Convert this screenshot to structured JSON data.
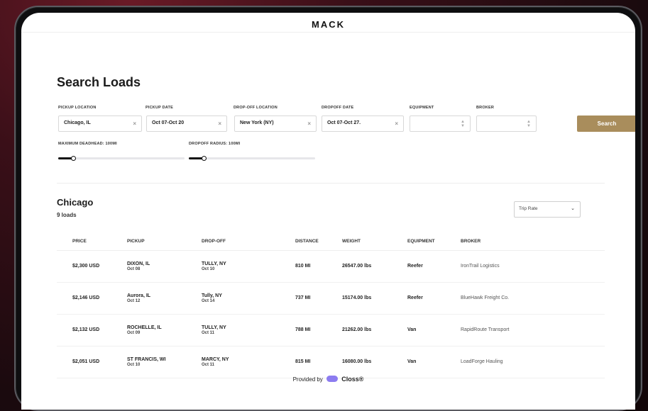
{
  "app": {
    "logo": "MACK"
  },
  "page": {
    "title": "Search Loads"
  },
  "search": {
    "pickup_location": {
      "label": "PICKUP LOCATION",
      "value": "Chicago, IL"
    },
    "pickup_date": {
      "label": "PICKUP DATE",
      "value": "Oct 07-Oct 20"
    },
    "dropoff_location": {
      "label": "DROP-OFF LOCATION",
      "value": "New York (NY)"
    },
    "dropoff_date": {
      "label": "DROPOFF DATE",
      "value": "Oct 07-Oct 27."
    },
    "equipment": {
      "label": "EQUIPMENT",
      "value": ""
    },
    "broker": {
      "label": "BROKER",
      "value": ""
    },
    "search_button": "Search",
    "max_deadhead": {
      "label": "MAXIMUM DEADHEAD: 100MI",
      "fraction": 0.12
    },
    "dropoff_radius": {
      "label": "DROPOFF RADIUS: 100MI",
      "fraction": 0.12
    },
    "clear_icon": "×"
  },
  "results": {
    "group_title": "Chicago",
    "count_text": "9 loads",
    "sort": {
      "value": "Trip Rate"
    },
    "columns": [
      "PRICE",
      "PICKUP",
      "DROP-OFF",
      "DISTANCE",
      "WEIGHT",
      "EQUIPMENT",
      "BROKER"
    ],
    "rows": [
      {
        "price": "$2,300 USD",
        "pickup_city": "DIXON, IL",
        "pickup_date": "Oct 08",
        "drop_city": "TULLY, NY",
        "drop_date": "Oct 10",
        "distance": "810 MI",
        "weight": "26547.00 lbs",
        "equipment": "Reefer",
        "broker": "IronTrail Logistics"
      },
      {
        "price": "$2,146 USD",
        "pickup_city": "Aurora, IL",
        "pickup_date": "Oct 12",
        "drop_city": "Tully, NY",
        "drop_date": "Oct 14",
        "distance": "737 MI",
        "weight": "15174.00 lbs",
        "equipment": "Reefer",
        "broker": "BlueHawk Freight Co."
      },
      {
        "price": "$2,132 USD",
        "pickup_city": "ROCHELLE, IL",
        "pickup_date": "Oct 09",
        "drop_city": "TULLY, NY",
        "drop_date": "Oct 11",
        "distance": "788 MI",
        "weight": "21262.00 lbs",
        "equipment": "Van",
        "broker": "RapidRoute Transport"
      },
      {
        "price": "$2,051 USD",
        "pickup_city": "ST FRANCIS, WI",
        "pickup_date": "Oct 10",
        "drop_city": "MARCY, NY",
        "drop_date": "Oct 11",
        "distance": "815 MI",
        "weight": "16080.00 lbs",
        "equipment": "Van",
        "broker": "LoadForge Hauling"
      }
    ]
  },
  "footer": {
    "provided_by": "Provided by",
    "brand": "Closs®"
  },
  "colors": {
    "accent": "#a98d5c",
    "brand_mark": "#8c7cf0"
  }
}
